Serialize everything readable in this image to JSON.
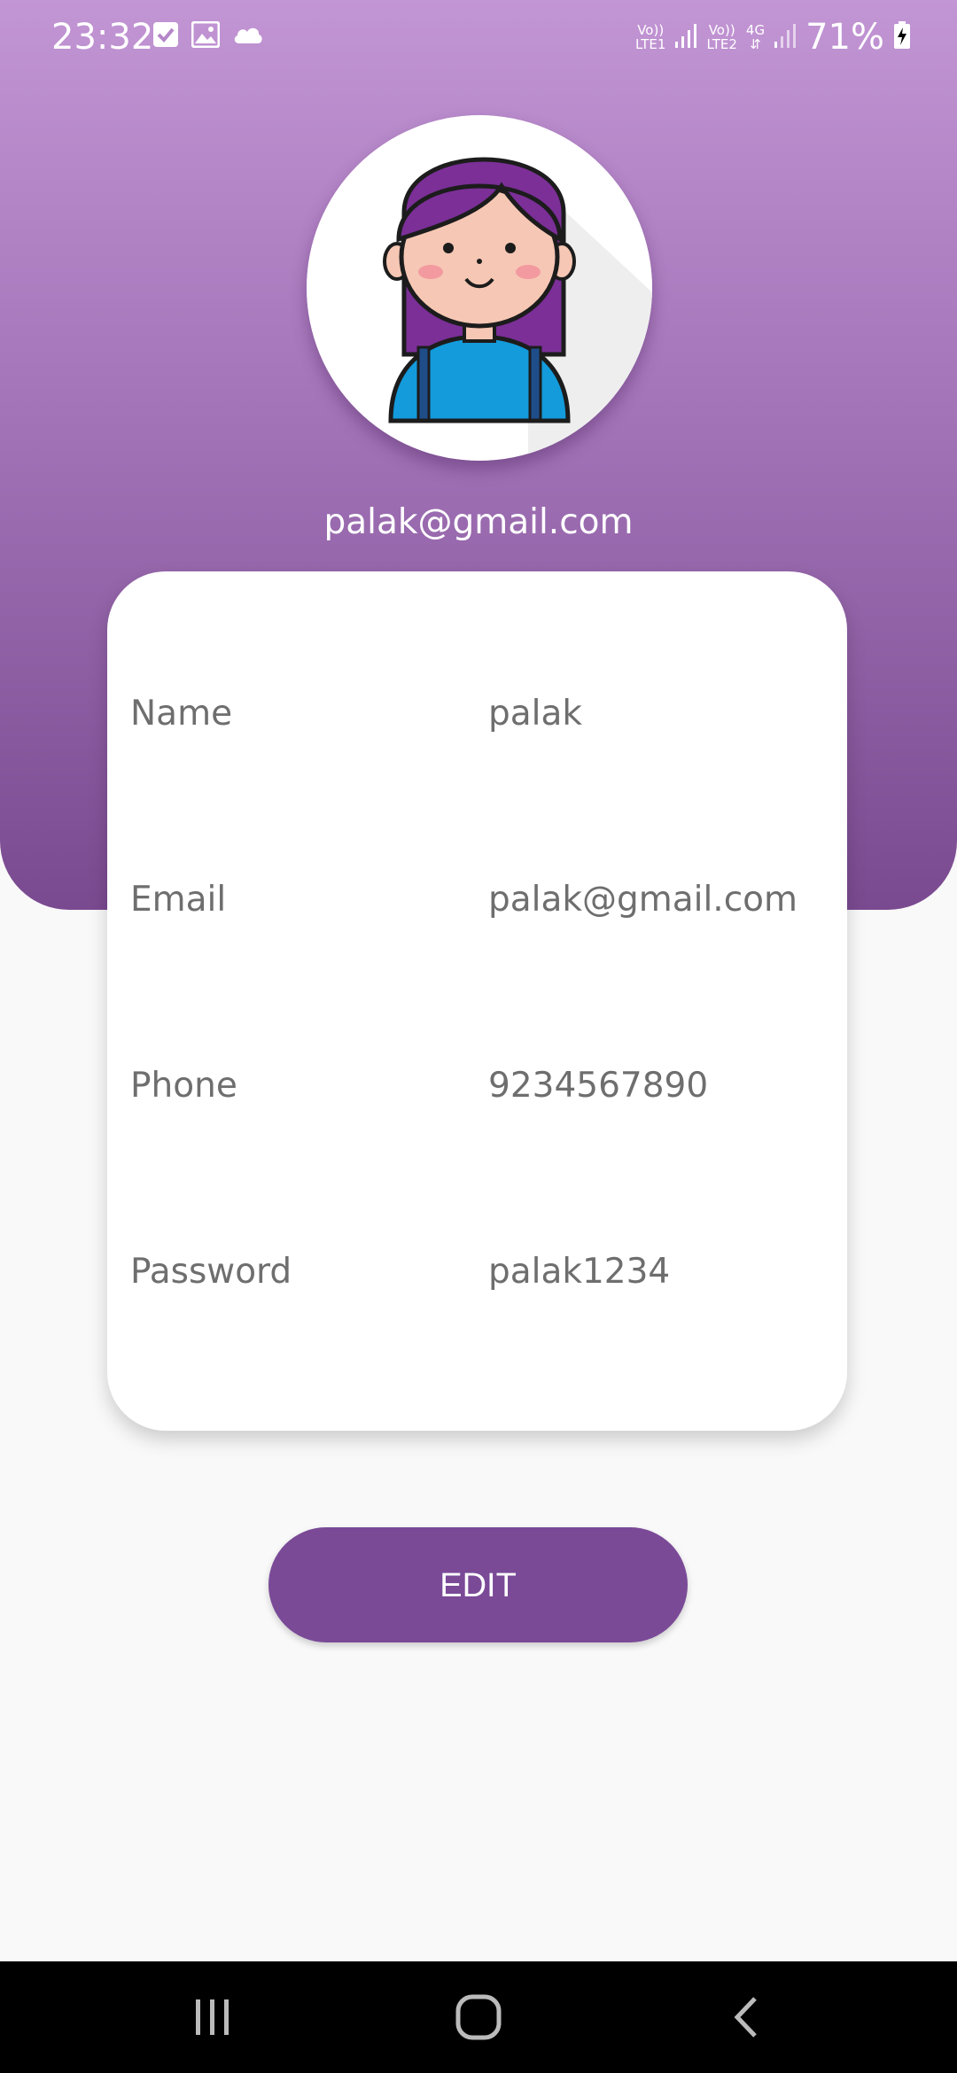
{
  "status_bar": {
    "time": "23:32",
    "left_icons": [
      "check-box-icon",
      "image-icon",
      "cloud-icon"
    ],
    "sim1_label_top": "Vo))",
    "sim1_label_bottom": "LTE1",
    "sim2_label_top": "Vo))",
    "sim2_label_bottom": "LTE2",
    "network_type": "4G",
    "battery_percent": "71%"
  },
  "profile": {
    "email": "palak@gmail.com"
  },
  "details": [
    {
      "label": "Name",
      "value": "palak"
    },
    {
      "label": "Email",
      "value": "palak@gmail.com"
    },
    {
      "label": "Phone",
      "value": "9234567890"
    },
    {
      "label": "Password",
      "value": "palak1234"
    }
  ],
  "actions": {
    "edit_label": "EDIT"
  },
  "navigation": {
    "items": [
      "recent-apps-icon",
      "home-icon",
      "back-icon"
    ]
  },
  "colors": {
    "header_top": "#c295d4",
    "header_bottom": "#7a4a90",
    "button": "#7a4a97",
    "background": "#f9f9f9"
  }
}
